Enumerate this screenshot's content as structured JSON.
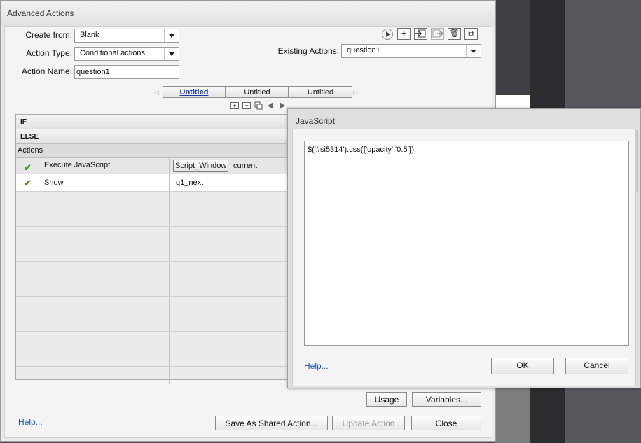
{
  "window": {
    "title": "Advanced Actions"
  },
  "form": {
    "create_from_label": "Create from:",
    "create_from_value": "Blank",
    "action_type_label": "Action Type:",
    "action_type_value": "Conditional actions",
    "action_name_label": "Action Name:",
    "action_name_value": "question1",
    "existing_actions_label": "Existing Actions:",
    "existing_actions_value": "question1"
  },
  "toolbar": {
    "add_glyph": "+",
    "delete_glyph": "🗑",
    "duplicate_glyph": "⧉"
  },
  "tabs": [
    {
      "label": "Untitled",
      "active": true
    },
    {
      "label": "Untitled",
      "active": false
    },
    {
      "label": "Untitled",
      "active": false
    }
  ],
  "subtoolbar": {
    "add": "+",
    "remove": "−"
  },
  "grid": {
    "if_label": "IF",
    "else_label": "ELSE",
    "actions_label": "Actions",
    "rows": [
      {
        "action": "Execute JavaScript",
        "target_button": "Script_Window",
        "target": "current"
      },
      {
        "action": "Show",
        "target": "q1_next"
      }
    ],
    "empty_rows": 11
  },
  "buttons": {
    "usage": "Usage",
    "variables": "Variables...",
    "save_shared": "Save As Shared Action...",
    "update_action": "Update Action",
    "close": "Close",
    "help": "Help..."
  },
  "js_dialog": {
    "title": "JavaScript",
    "code": "$('#si5314').css({'opacity':'0.5'});",
    "help": "Help...",
    "ok": "OK",
    "cancel": "Cancel"
  },
  "colors": {
    "accent_link": "#2255a4",
    "check": "#3c9b19",
    "active_tab": "#1a3aa0"
  }
}
